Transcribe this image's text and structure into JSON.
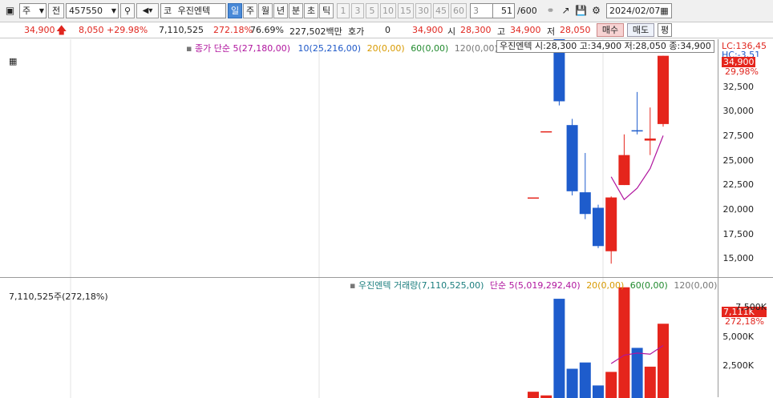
{
  "toolbar": {
    "period_select": "주",
    "prev_label": "전",
    "code": "457550",
    "market_tag": "코",
    "stock_name": "우진엔텍",
    "periods": [
      "일",
      "주",
      "월",
      "년",
      "분",
      "초",
      "틱"
    ],
    "selected_period": "일",
    "minutes": [
      "1",
      "3",
      "5",
      "10",
      "15",
      "30",
      "45",
      "60"
    ],
    "interval": "3",
    "count": "51",
    "count_total": "/600",
    "date": "2024/02/07"
  },
  "quote": {
    "price": "34,900",
    "change": "8,050",
    "change_pct": "+29.98%",
    "volume": "7,110,525",
    "volume_ratio": "272.18%",
    "turnover": "76.69%",
    "amount": "227,502백만",
    "hoga_label": "호가",
    "hoga_value": "0",
    "last": "34,900",
    "open_label": "시",
    "open": "28,300",
    "high_label": "고",
    "high": "34,900",
    "low_label": "저",
    "low": "28,050",
    "buy_label": "매수",
    "sell_label": "매도",
    "eval_label": "평"
  },
  "price_panel": {
    "legend_ma_title": "종가 단순",
    "legend_ma5": "5(27,180,00)",
    "legend_ma10": "10(25,216,00)",
    "legend_ma20": "20(0,00)",
    "legend_ma60": "60(0,00)",
    "legend_ma120": "120(0,00)",
    "info_box": "우진엔텍 시:28,300 고:34,900 저:28,050 종:34,900",
    "lc": "LC:136,45",
    "hc": "HC:-3,51",
    "cur_price": "34,900",
    "cur_pct": "29,98%",
    "ticks": [
      "32,500",
      "30,000",
      "27,500",
      "25,000",
      "22,500",
      "20,000",
      "17,500",
      "15,000"
    ]
  },
  "volume_panel": {
    "left_label": "7,110,525주(272,18%)",
    "legend_title": "우진엔텍 거래량(7,110,525,00)",
    "legend_ma_title": "단순",
    "legend_ma5": "5(5,019,292,40)",
    "legend_ma20": "20(0,00)",
    "legend_ma60": "60(0,00)",
    "legend_ma120": "120(0,00)",
    "cur_vol": "7,111K",
    "cur_pct": "272,18%",
    "ticks": [
      "7,500K",
      "5,000K",
      "2,500K"
    ]
  },
  "colors": {
    "up": "#e5251c",
    "down": "#1e5ccc",
    "ma5": "#b0159e",
    "bg_bar": "#f0f0f0"
  },
  "chart_data": [
    {
      "type": "candlestick",
      "series": [
        {
          "o": 21200,
          "h": 21200,
          "l": 21200,
          "c": 21200
        },
        {
          "o": 27600,
          "h": 27600,
          "l": 27600,
          "c": 27600
        },
        {
          "o": 36900,
          "h": 36900,
          "l": 30100,
          "c": 30500
        },
        {
          "o": 28200,
          "h": 28800,
          "l": 21400,
          "c": 21800
        },
        {
          "o": 21700,
          "h": 25500,
          "l": 19100,
          "c": 19600
        },
        {
          "o": 20200,
          "h": 20500,
          "l": 16300,
          "c": 16500
        },
        {
          "o": 16000,
          "h": 21300,
          "l": 14800,
          "c": 21200
        },
        {
          "o": 22400,
          "h": 27300,
          "l": 22400,
          "c": 25300
        },
        {
          "o": 27700,
          "h": 31400,
          "l": 27300,
          "c": 27600
        },
        {
          "o": 26700,
          "h": 29900,
          "l": 25300,
          "c": 26900
        },
        {
          "o": 28300,
          "h": 34900,
          "l": 28050,
          "c": 34900
        }
      ],
      "ma5": [
        null,
        null,
        null,
        null,
        null,
        null,
        23200,
        21000,
        22100,
        24000,
        27180
      ],
      "ylim": [
        13500,
        36500
      ]
    },
    {
      "type": "bar",
      "values": [
        600,
        250,
        9500,
        2800,
        3400,
        1200,
        2500,
        10600,
        4800,
        3000,
        7110
      ],
      "ma5": [
        null,
        null,
        null,
        null,
        null,
        null,
        3300,
        4100,
        4300,
        4200,
        5019
      ],
      "ylim": [
        0,
        11500
      ]
    }
  ]
}
